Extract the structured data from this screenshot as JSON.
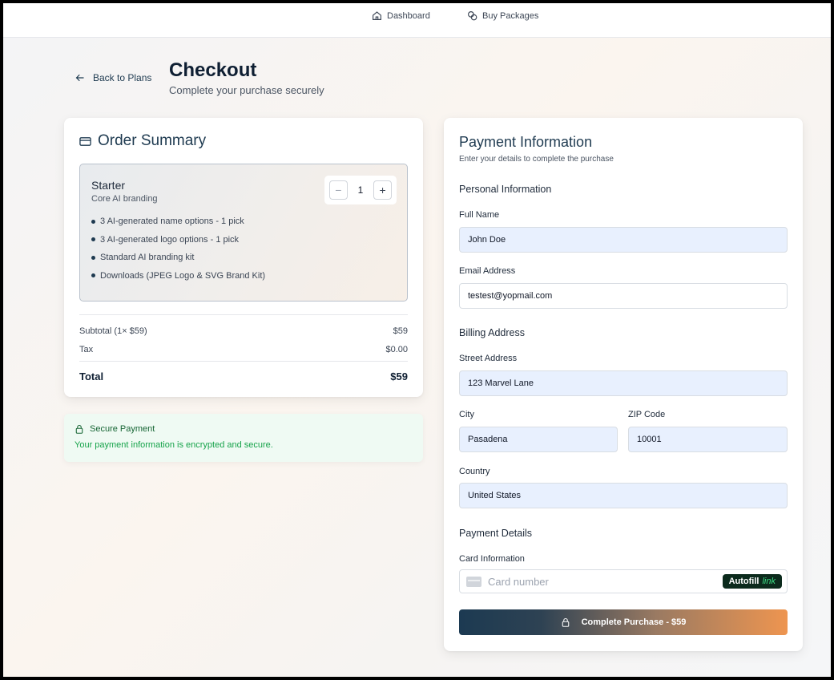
{
  "nav": {
    "dashboard": "Dashboard",
    "buy_packages": "Buy Packages"
  },
  "header": {
    "back_label": "Back to Plans",
    "title": "Checkout",
    "subtitle": "Complete your purchase securely"
  },
  "summary": {
    "title": "Order Summary",
    "plan": {
      "name": "Starter",
      "description": "Core AI branding",
      "quantity": "1",
      "features": [
        "3 AI-generated name options - 1 pick",
        "3 AI-generated logo options - 1 pick",
        "Standard AI branding kit",
        "Downloads (JPEG Logo & SVG Brand Kit)"
      ]
    },
    "subtotal_label": "Subtotal (1× $59)",
    "subtotal_value": "$59",
    "tax_label": "Tax",
    "tax_value": "$0.00",
    "total_label": "Total",
    "total_value": "$59"
  },
  "secure": {
    "title": "Secure Payment",
    "text": "Your payment information is encrypted and secure."
  },
  "payment": {
    "title": "Payment Information",
    "subtitle": "Enter your details to complete the purchase",
    "personal_heading": "Personal Information",
    "full_name_label": "Full Name",
    "full_name_value": "John Doe",
    "email_label": "Email Address",
    "email_value": "testest@yopmail.com",
    "billing_heading": "Billing Address",
    "street_label": "Street Address",
    "street_value": "123 Marvel Lane",
    "city_label": "City",
    "city_value": "Pasadena",
    "zip_label": "ZIP Code",
    "zip_value": "10001",
    "country_label": "Country",
    "country_value": "United States",
    "payment_heading": "Payment Details",
    "card_label": "Card Information",
    "card_placeholder": "Card number",
    "autofill_label": "Autofill",
    "autofill_link": "link",
    "submit_label": "Complete Purchase - $59"
  },
  "colors": {
    "brand_dark": "#1c3a52",
    "brand_orange": "#ee9550",
    "secure_green": "#16a34a",
    "autofill_bg": "#0b2a1c"
  }
}
